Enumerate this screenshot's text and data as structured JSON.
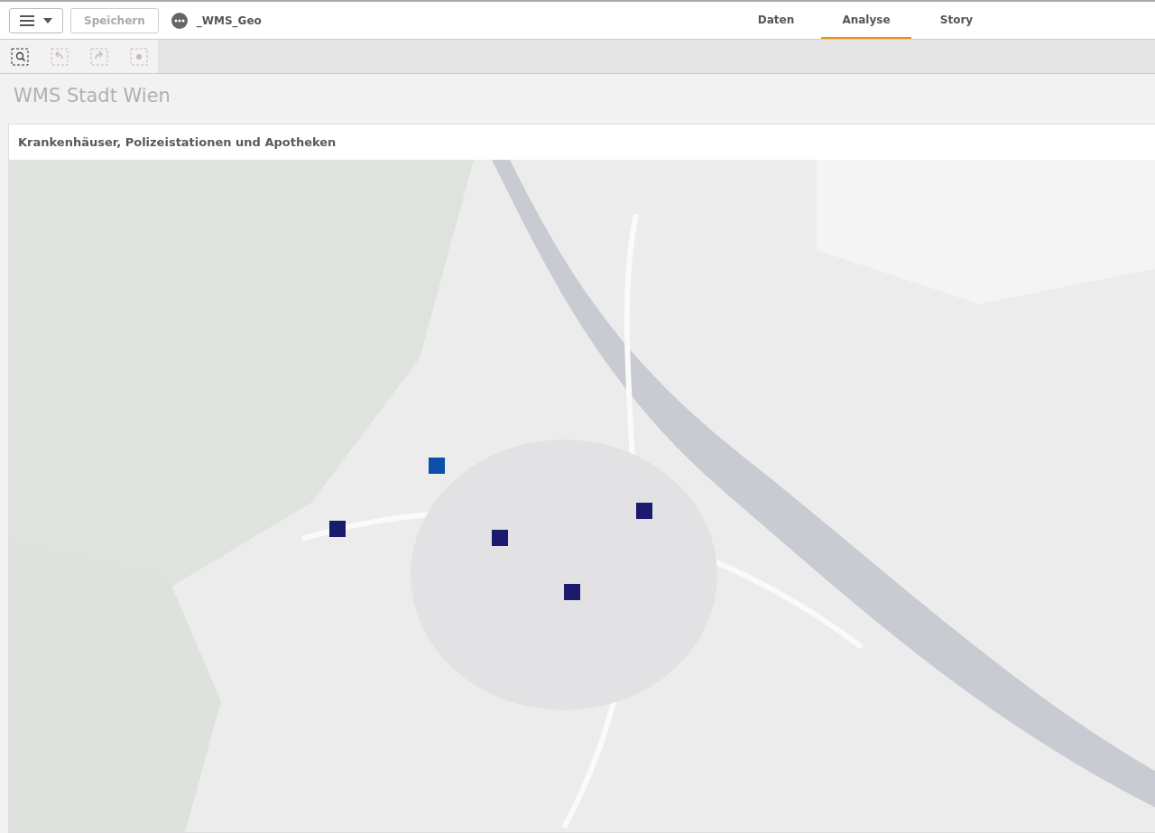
{
  "topbar": {
    "save_button": {
      "label": "Speichern",
      "disabled": true
    },
    "app_title": "_WMS_Geo"
  },
  "tabs": [
    {
      "label": "Daten",
      "selected": false
    },
    {
      "label": "Analyse",
      "selected": true
    },
    {
      "label": "Story",
      "selected": false
    }
  ],
  "tools": [
    {
      "kind": "lasso",
      "disabled": false
    },
    {
      "kind": "back",
      "disabled": true
    },
    {
      "kind": "forward",
      "disabled": true
    },
    {
      "kind": "clear",
      "disabled": true
    }
  ],
  "sheet_title": "WMS Stadt Wien",
  "map_card": {
    "title": "Krankenhäuser, Polizeistationen und Apotheken"
  }
}
